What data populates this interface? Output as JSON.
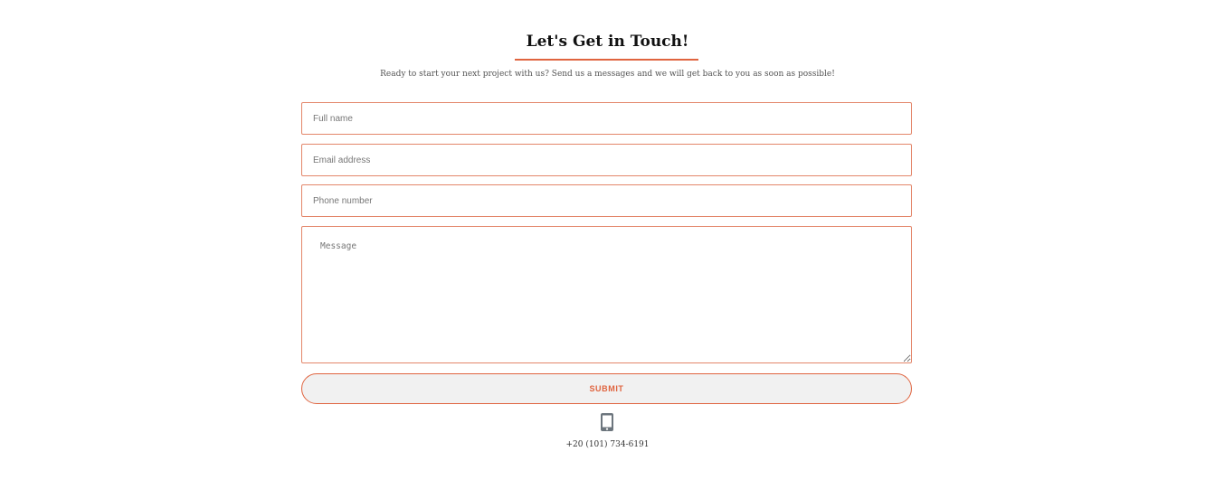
{
  "contact": {
    "title": "Let's Get in Touch!",
    "subtitle": "Ready to start your next project with us? Send us a messages and we will get back to you as soon as possible!"
  },
  "form": {
    "full_name": {
      "value": "",
      "placeholder": "Full name"
    },
    "email": {
      "value": "",
      "placeholder": "Email address"
    },
    "phone": {
      "value": "",
      "placeholder": "Phone number"
    },
    "message": {
      "value": "",
      "placeholder": "Message"
    },
    "submit_label": "SUBMIT"
  },
  "footer": {
    "phone_icon": "mobile-phone-icon",
    "phone_number": "+20 (101) 734-6191"
  },
  "colors": {
    "accent": "#e0643f",
    "field_border": "#e3866a",
    "button_bg": "#f1f1f1",
    "icon": "#6c757d"
  }
}
